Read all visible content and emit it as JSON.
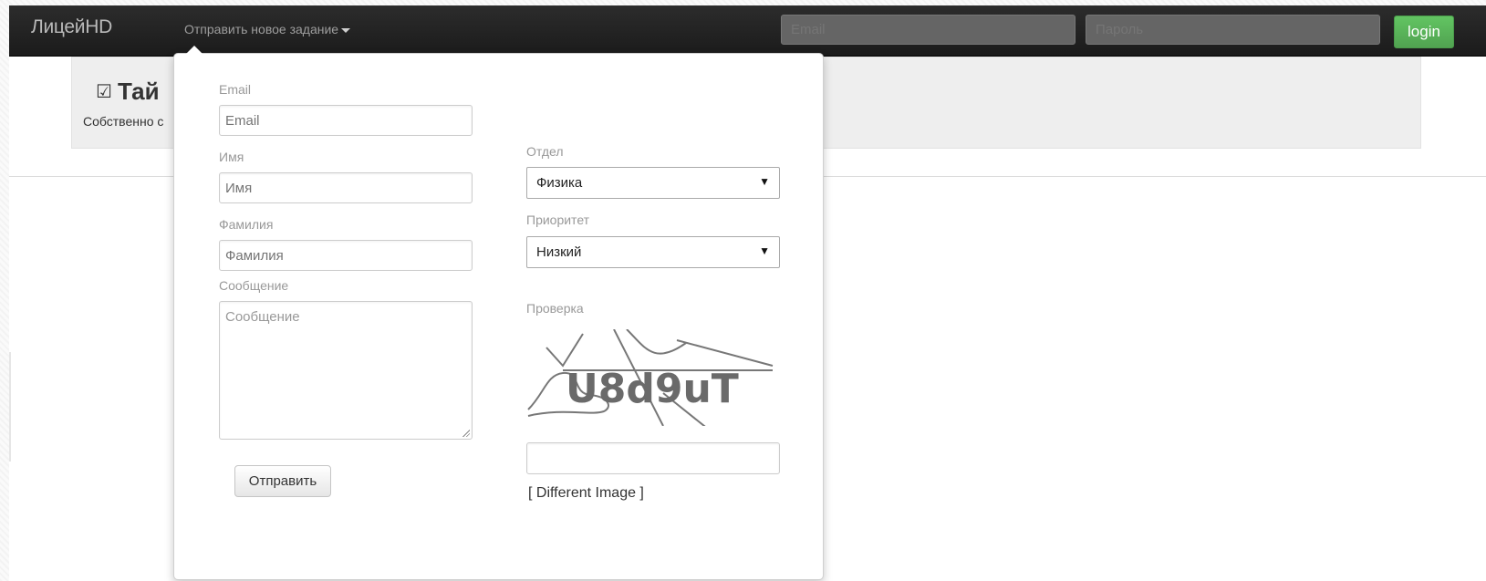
{
  "navbar": {
    "brand": "ЛицейHD",
    "dropdown_label": "Отправить новое задание",
    "email_placeholder": "Email",
    "password_placeholder": "Пароль",
    "login_label": "login"
  },
  "hero": {
    "title": "Тай",
    "text": "Собственно с"
  },
  "form": {
    "email_label": "Email",
    "email_placeholder": "Email",
    "name_label": "Имя",
    "name_placeholder": "Имя",
    "surname_label": "Фамилия",
    "surname_placeholder": "Фамилия",
    "message_label": "Сообщение",
    "message_placeholder": "Сообщение",
    "submit_label": "Отправить",
    "department_label": "Отдел",
    "department_value": "Физика",
    "priority_label": "Приоритет",
    "priority_value": "Низкий",
    "captcha_label": "Проверка",
    "captcha_text": "U8d9uT",
    "captcha_input_value": "",
    "different_image_label": "[ Different Image ]"
  },
  "colors": {
    "navbar_bg": "#222222",
    "login_green": "#5bb75b",
    "hero_bg": "#eeeeee"
  },
  "icons": {
    "hero_icon": "check-square-icon",
    "dropdown_icon": "caret-down-icon",
    "select_icon": "triangle-down-icon"
  }
}
